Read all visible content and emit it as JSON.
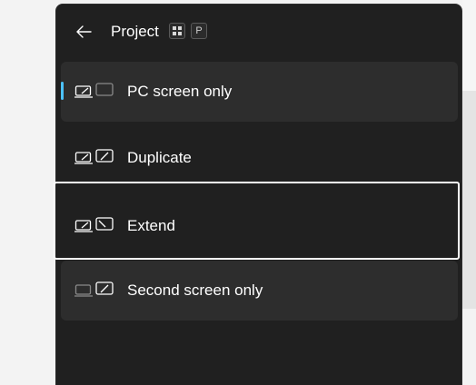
{
  "header": {
    "title": "Project",
    "shortcut_key": "P"
  },
  "options": [
    {
      "label": "PC screen only",
      "icon": "pc-screen-only-icon",
      "selected": true
    },
    {
      "label": "Duplicate",
      "icon": "duplicate-icon",
      "selected": false
    },
    {
      "label": "Extend",
      "icon": "extend-icon",
      "selected": false,
      "focused": true
    },
    {
      "label": "Second screen only",
      "icon": "second-screen-only-icon",
      "selected": false
    }
  ],
  "colors": {
    "accent": "#4cc2ff",
    "panel": "#202020",
    "item_bg": "#2d2d2d"
  }
}
